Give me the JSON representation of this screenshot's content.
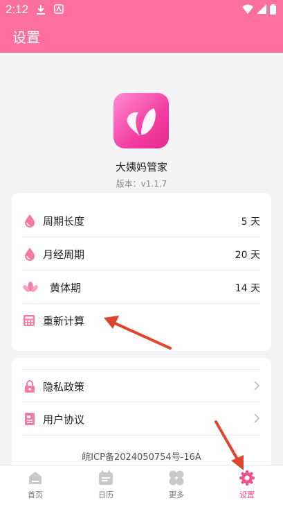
{
  "status_bar": {
    "time": "2:12"
  },
  "header": {
    "title": "设置"
  },
  "app_info": {
    "name": "大姨妈管家",
    "version": "版本：v1.1.7"
  },
  "cycle_settings": [
    {
      "label": "周期长度",
      "value": "5 天"
    },
    {
      "label": "月经周期",
      "value": "20 天"
    },
    {
      "label": "黄体期",
      "value": "14 天"
    },
    {
      "label": "重新计算"
    }
  ],
  "legal_links": [
    {
      "label": "隐私政策"
    },
    {
      "label": "用户协议"
    }
  ],
  "icp": "皖ICP备2024050754号-16A",
  "tabs": [
    {
      "label": "首页"
    },
    {
      "label": "日历"
    },
    {
      "label": "更多"
    },
    {
      "label": "设置"
    }
  ],
  "colors": {
    "accent": "#fd6f9f",
    "tab_active": "#f2528a",
    "arrow": "#e0452e"
  }
}
